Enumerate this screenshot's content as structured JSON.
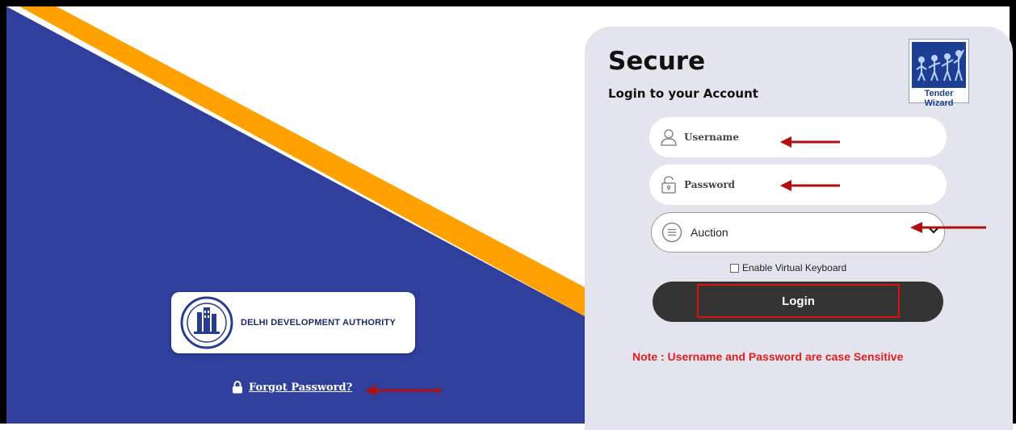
{
  "login_panel": {
    "title": "Secure",
    "subtitle": "Login to your Account",
    "username": {
      "placeholder": "Username",
      "icon": "user-icon"
    },
    "password": {
      "placeholder": "Password",
      "icon": "lock-icon"
    },
    "login_type": {
      "selected": "Auction",
      "icon": "list-icon"
    },
    "virtual_keyboard": {
      "label": "Enable Virtual Keyboard",
      "checked": false
    },
    "login_button": "Login",
    "note": "Note : Username and Password are case Sensitive"
  },
  "brand": {
    "tender_wizard": "Tender Wizard",
    "dda_name": "DELHI DEVELOPMENT AUTHORITY"
  },
  "forgot_password": "Forgot Password?",
  "colors": {
    "navy": "#303f9c",
    "orange": "#ffa100",
    "panel": "#e3e4ee",
    "button": "#343434",
    "accent_red": "#e02020",
    "arrow_red": "#b00f0f"
  }
}
